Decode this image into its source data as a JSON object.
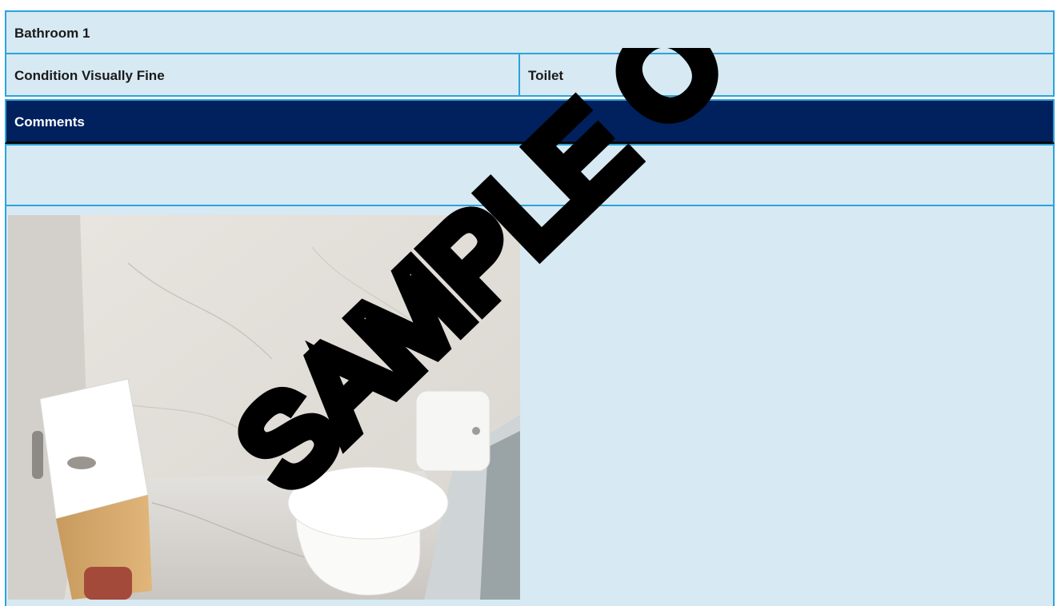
{
  "section": {
    "title": "Bathroom 1"
  },
  "condition": {
    "label": "Condition Visually Fine",
    "item": "Toilet"
  },
  "comments": {
    "heading": "Comments",
    "text": ""
  },
  "photo": {
    "subject": "toilet-and-vanity-photo"
  },
  "watermark": {
    "text": "SAMPLE O"
  },
  "colors": {
    "row_bg": "#d7e9f2",
    "border": "#2ba4dc",
    "header_bg": "#00215d",
    "header_text": "#ffffff"
  }
}
